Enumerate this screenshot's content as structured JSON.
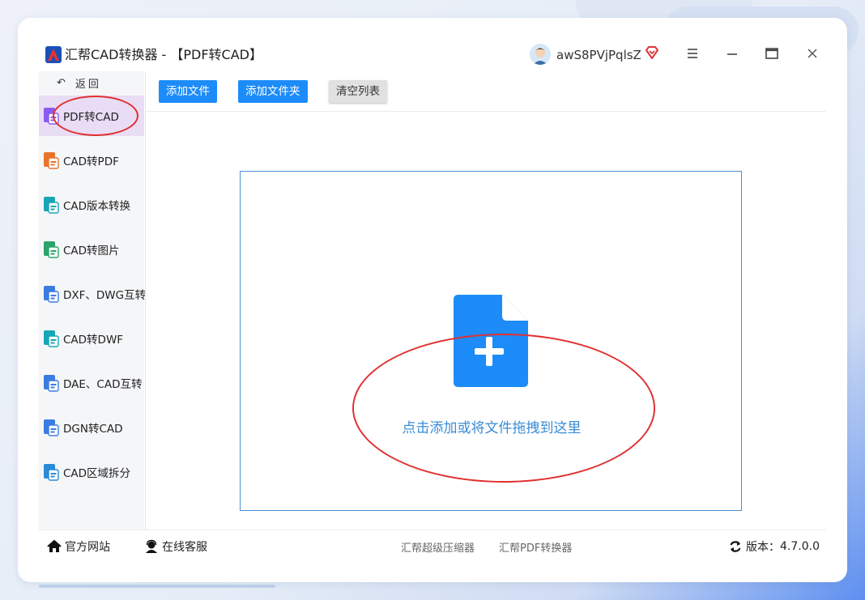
{
  "window": {
    "title": "汇帮CAD转换器 - 【PDF转CAD】",
    "username": "awS8PVjPqlsZ"
  },
  "sidebar": {
    "back_label": "返回",
    "items": [
      {
        "label": "PDF转CAD",
        "active": true
      },
      {
        "label": "CAD转PDF",
        "active": false
      },
      {
        "label": "CAD版本转换",
        "active": false
      },
      {
        "label": "CAD转图片",
        "active": false
      },
      {
        "label": "DXF、DWG互转",
        "active": false
      },
      {
        "label": "CAD转DWF",
        "active": false
      },
      {
        "label": "DAE、CAD互转",
        "active": false
      },
      {
        "label": "DGN转CAD",
        "active": false
      },
      {
        "label": "CAD区域拆分",
        "active": false
      }
    ]
  },
  "toolbar": {
    "add_file": "添加文件",
    "add_folder": "添加文件夹",
    "clear_list": "清空列表"
  },
  "dropzone": {
    "hint": "点击添加或将文件拖拽到这里"
  },
  "footer": {
    "website": "官方网站",
    "support": "在线客服",
    "link_compressor": "汇帮超级压缩器",
    "link_pdf": "汇帮PDF转换器",
    "version_label": "版本：",
    "version": "4.7.0.0"
  },
  "colors": {
    "accent": "#1d8cf8",
    "active_nav_bg": "#e9dcf5",
    "annotation_red": "#e03030"
  }
}
